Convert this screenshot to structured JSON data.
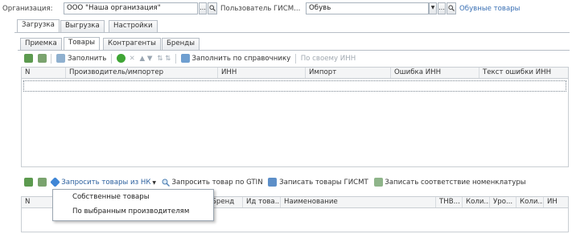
{
  "header": {
    "org_label": "Организация:",
    "org_value": "ООО \"Наша организация\"",
    "user_label": "Пользователь ГИСМ...",
    "user_value": "Обувь",
    "link_label": "Обувные товары"
  },
  "tabs_main": [
    {
      "label": "Загрузка",
      "active": true
    },
    {
      "label": "Выгрузка",
      "active": false
    },
    {
      "label": "Настройки",
      "active": false
    }
  ],
  "tabs_sub": [
    {
      "label": "Приемка",
      "active": false
    },
    {
      "label": "Товары",
      "active": true
    },
    {
      "label": "Контрагенты",
      "active": false
    },
    {
      "label": "Бренды",
      "active": false
    }
  ],
  "toolbar1": {
    "fill_label": "Заполнить",
    "fill_ref_label": "Заполнить по справочнику",
    "own_inn_label": "По своему ИНН"
  },
  "grid1": {
    "columns": [
      "N",
      "Производитель/импортер",
      "ИНН",
      "Импорт",
      "Ошибка ИНН",
      "Текст ошибки ИНН"
    ]
  },
  "toolbar2": {
    "request_nk_label": "Запросить товары из НК",
    "request_gtin_label": "Запросить товар по GTIN",
    "write_gismt_label": "Записать товары ГИСМТ",
    "write_match_label": "Записать соответствие номенклатуры"
  },
  "grid2": {
    "columns": [
      "N",
      "Бренд",
      "Ид това...",
      "Наименование",
      "ТНВ...",
      "Коли...",
      "Уро...",
      "Коли...",
      "ИН"
    ]
  },
  "dropdown": {
    "items": [
      "Собственные товары",
      "По выбранным производителям"
    ]
  },
  "colors": {
    "link": "#3a70b4",
    "green_icon": "#3fa535",
    "blue_icon": "#3f86d6"
  }
}
